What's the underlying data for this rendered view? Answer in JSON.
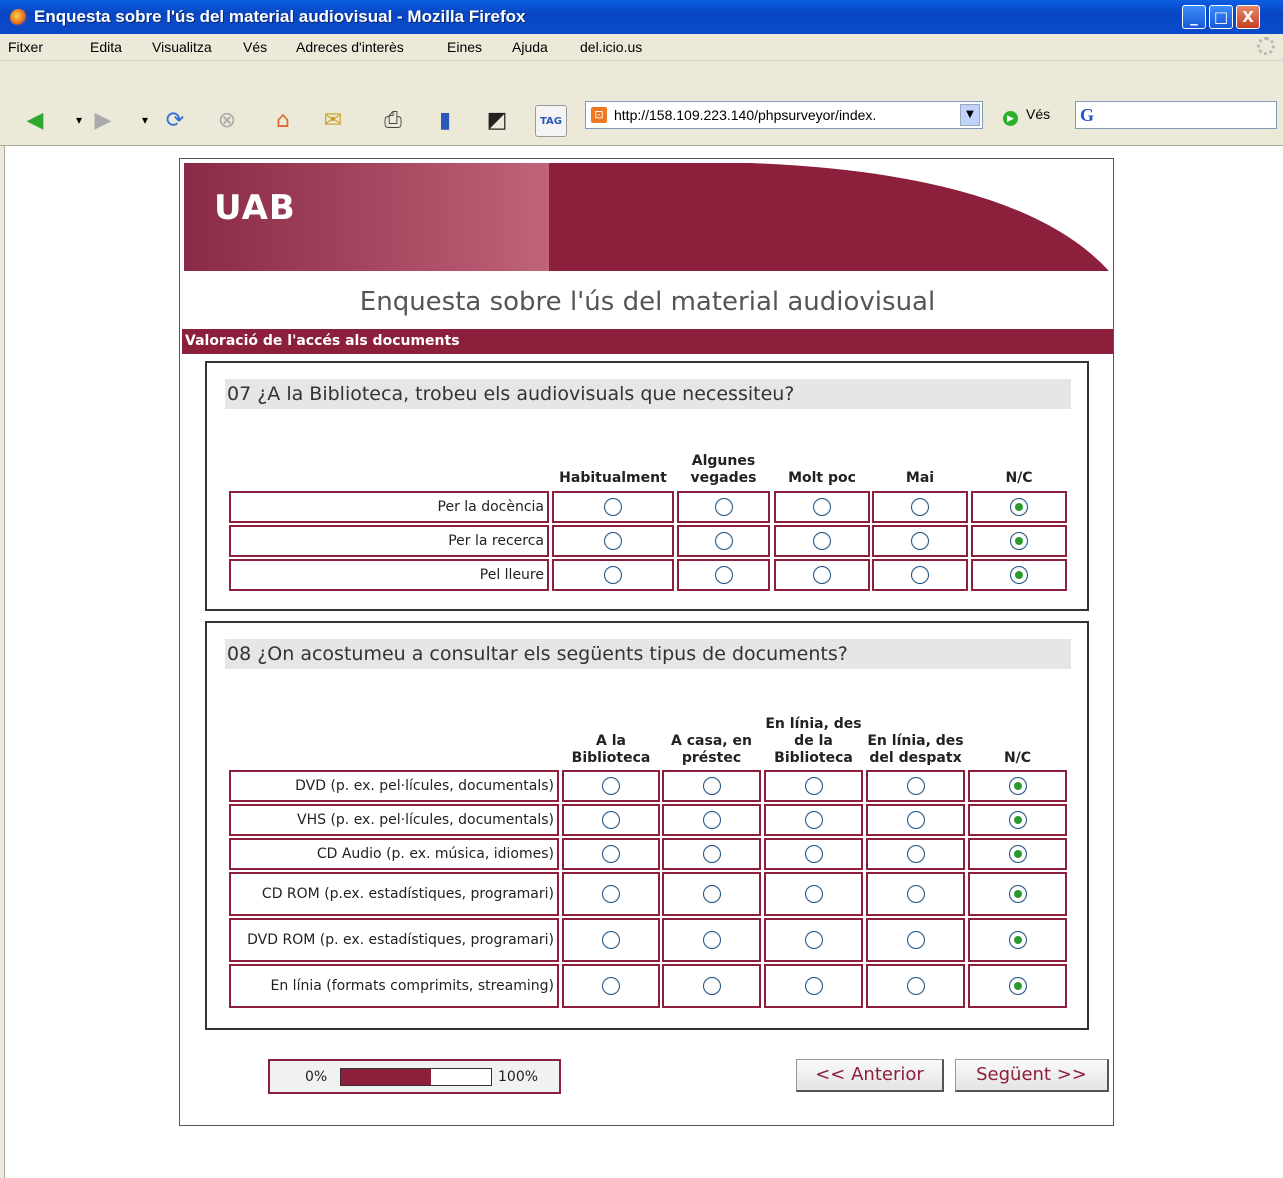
{
  "window": {
    "title": "Enquesta sobre l'ús del material audiovisual - Mozilla Firefox",
    "min": "_",
    "max": "□",
    "close": "X"
  },
  "menu": [
    "Fitxer",
    "Edita",
    "Visualitza",
    "Vés",
    "Adreces d'interès",
    "Eines",
    "Ajuda",
    "del.icio.us"
  ],
  "toolbar": {
    "url": "http://158.109.223.140/phpsurveyor/index.",
    "go": "Vés",
    "google": "G",
    "tag": "TAG"
  },
  "banner": {
    "logo": "UAB"
  },
  "survey": {
    "title": "Enquesta sobre l'ús del material audiovisual",
    "section": "Valoració de l'accés als documents"
  },
  "q07": {
    "title": "07 ¿A la Biblioteca, trobeu els audiovisuals que necessiteu?",
    "columns": [
      "Habitualment",
      "Algunes vegades",
      "Molt poc",
      "Mai",
      "N/C"
    ],
    "rows": [
      "Per la docència",
      "Per la recerca",
      "Pel lleure"
    ],
    "selected_column": "N/C"
  },
  "q08": {
    "title": "08 ¿On acostumeu a consultar els següents tipus de documents?",
    "columns": [
      "A la Biblioteca",
      "A casa, en préstec",
      "En línia, des de la Biblioteca",
      "En línia, des del despatx",
      "N/C"
    ],
    "rows": [
      "DVD (p. ex. pel·lícules, documentals)",
      "VHS (p. ex. pel·lícules, documentals)",
      "CD Audio (p. ex. música, idiomes)",
      "CD ROM (p.ex. estadístiques, programari)",
      "DVD ROM (p. ex. estadístiques, programari)",
      "En línia (formats comprimits, streaming)"
    ],
    "selected_column": "N/C"
  },
  "progress": {
    "start_label": "0%",
    "end_label": "100%",
    "value": 0.6
  },
  "nav": {
    "prev": "<< Anterior",
    "next": "Següent >>"
  },
  "colors": {
    "accent": "#8c1f3c",
    "title_bar": "#0846c4"
  }
}
